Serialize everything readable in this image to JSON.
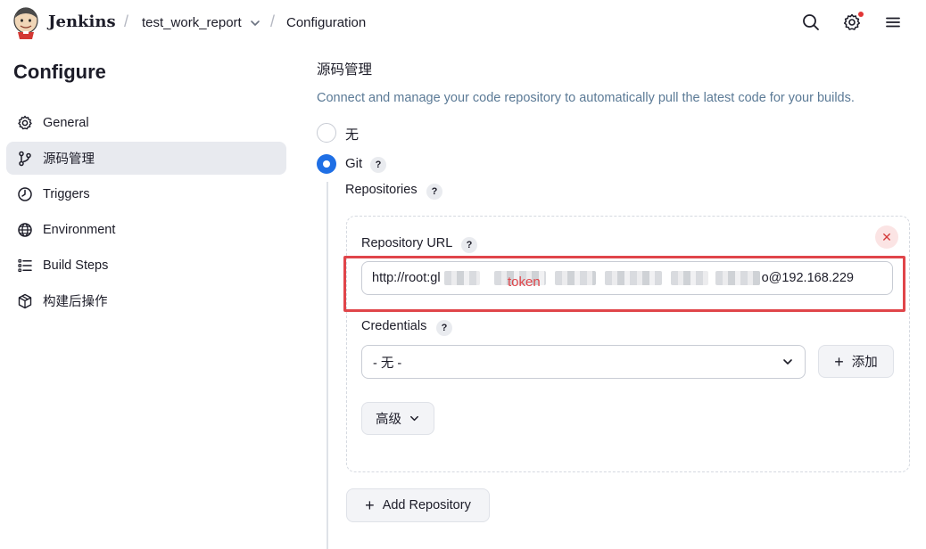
{
  "header": {
    "brand": "Jenkins",
    "breadcrumb": [
      "test_work_report",
      "Configuration"
    ],
    "separator": "/"
  },
  "sidebar": {
    "title": "Configure",
    "items": [
      {
        "label": "General",
        "icon": "gear-icon",
        "active": false
      },
      {
        "label": "源码管理",
        "icon": "git-branch-icon",
        "active": true
      },
      {
        "label": "Triggers",
        "icon": "clock-icon",
        "active": false
      },
      {
        "label": "Environment",
        "icon": "globe-icon",
        "active": false
      },
      {
        "label": "Build Steps",
        "icon": "list-icon",
        "active": false
      },
      {
        "label": "构建后操作",
        "icon": "package-icon",
        "active": false
      }
    ]
  },
  "main": {
    "section_title": "源码管理",
    "description": "Connect and manage your code repository to automatically pull the latest code for your builds.",
    "scm_options": [
      {
        "label": "无",
        "selected": false
      },
      {
        "label": "Git",
        "selected": true
      }
    ],
    "help_glyph": "?",
    "repositories_label": "Repositories",
    "repository_url_label": "Repository URL",
    "repository_url_prefix": "http://root:gl",
    "repository_url_suffix": "o@192.168.229",
    "annotation": "token",
    "credentials_label": "Credentials",
    "credentials_value": "- 无 -",
    "add_credentials_label": "添加",
    "advanced_label": "高级",
    "add_repository_label": "Add Repository",
    "close_glyph": "✕",
    "plus_glyph": "+"
  },
  "colors": {
    "accent": "#1f6fe5",
    "annotation_red": "#e0454a",
    "description_text": "#5b7a96"
  }
}
